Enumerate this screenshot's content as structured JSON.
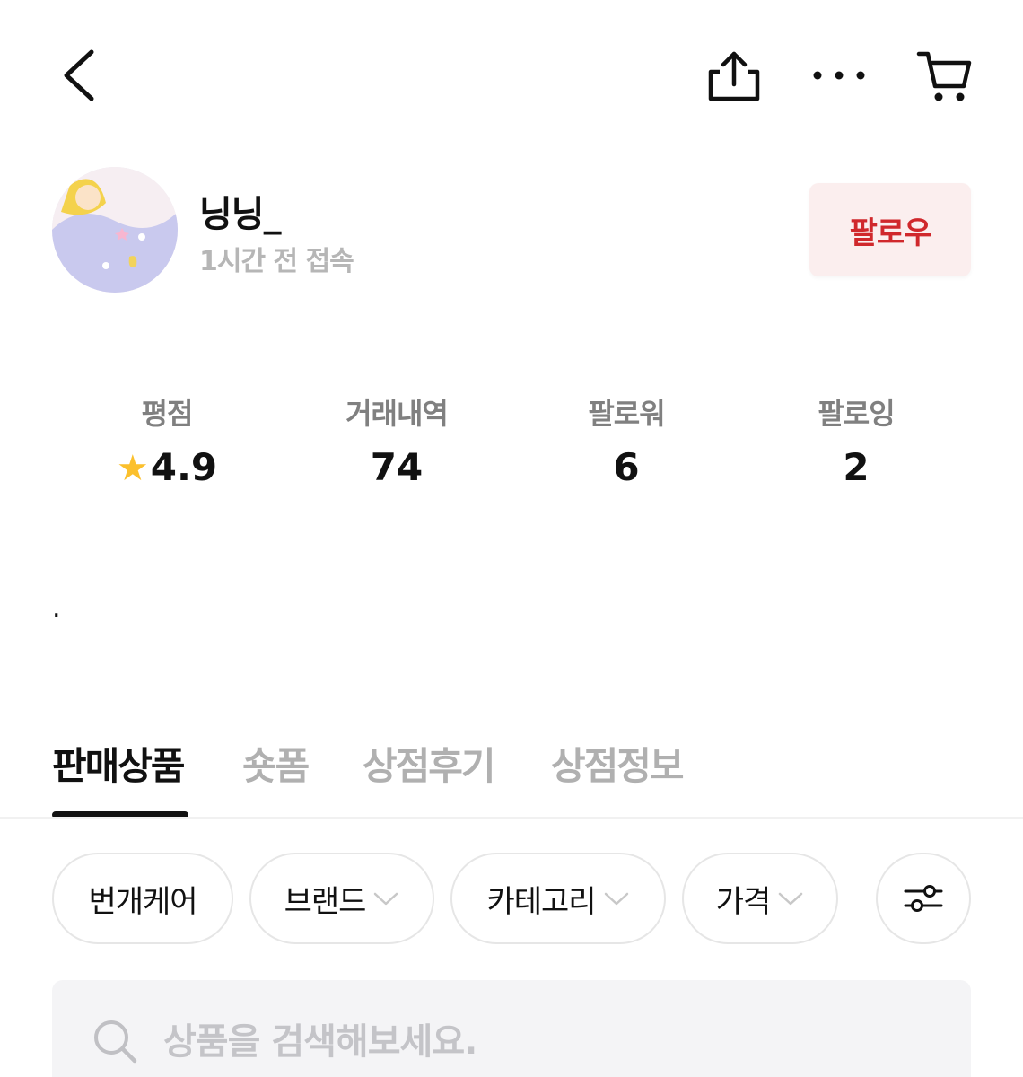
{
  "header": {
    "back_icon": "chevron-left-icon",
    "share_icon": "share-icon",
    "more_icon": "more-horizontal-icon",
    "cart_icon": "cart-icon"
  },
  "profile": {
    "nickname": "닝닝_",
    "last_seen": "1시간 전 접속",
    "follow_label": "팔로우",
    "follow_color": "#d0282c"
  },
  "stats": [
    {
      "label": "평점",
      "value": "4.9",
      "icon": "star-icon"
    },
    {
      "label": "거래내역",
      "value": "74"
    },
    {
      "label": "팔로워",
      "value": "6"
    },
    {
      "label": "팔로잉",
      "value": "2"
    }
  ],
  "bio": ".",
  "tabs": [
    {
      "label": "판매상품",
      "active": true
    },
    {
      "label": "숏폼"
    },
    {
      "label": "상점후기"
    },
    {
      "label": "상점정보"
    }
  ],
  "filters": [
    {
      "label": "번개케어"
    },
    {
      "label": "브랜드",
      "dropdown": true
    },
    {
      "label": "카테고리",
      "dropdown": true
    },
    {
      "label": "가격",
      "dropdown": true
    },
    {
      "icon": "filter-sliders-icon"
    }
  ],
  "search": {
    "placeholder": "상품을 검색해보세요.",
    "value": ""
  }
}
